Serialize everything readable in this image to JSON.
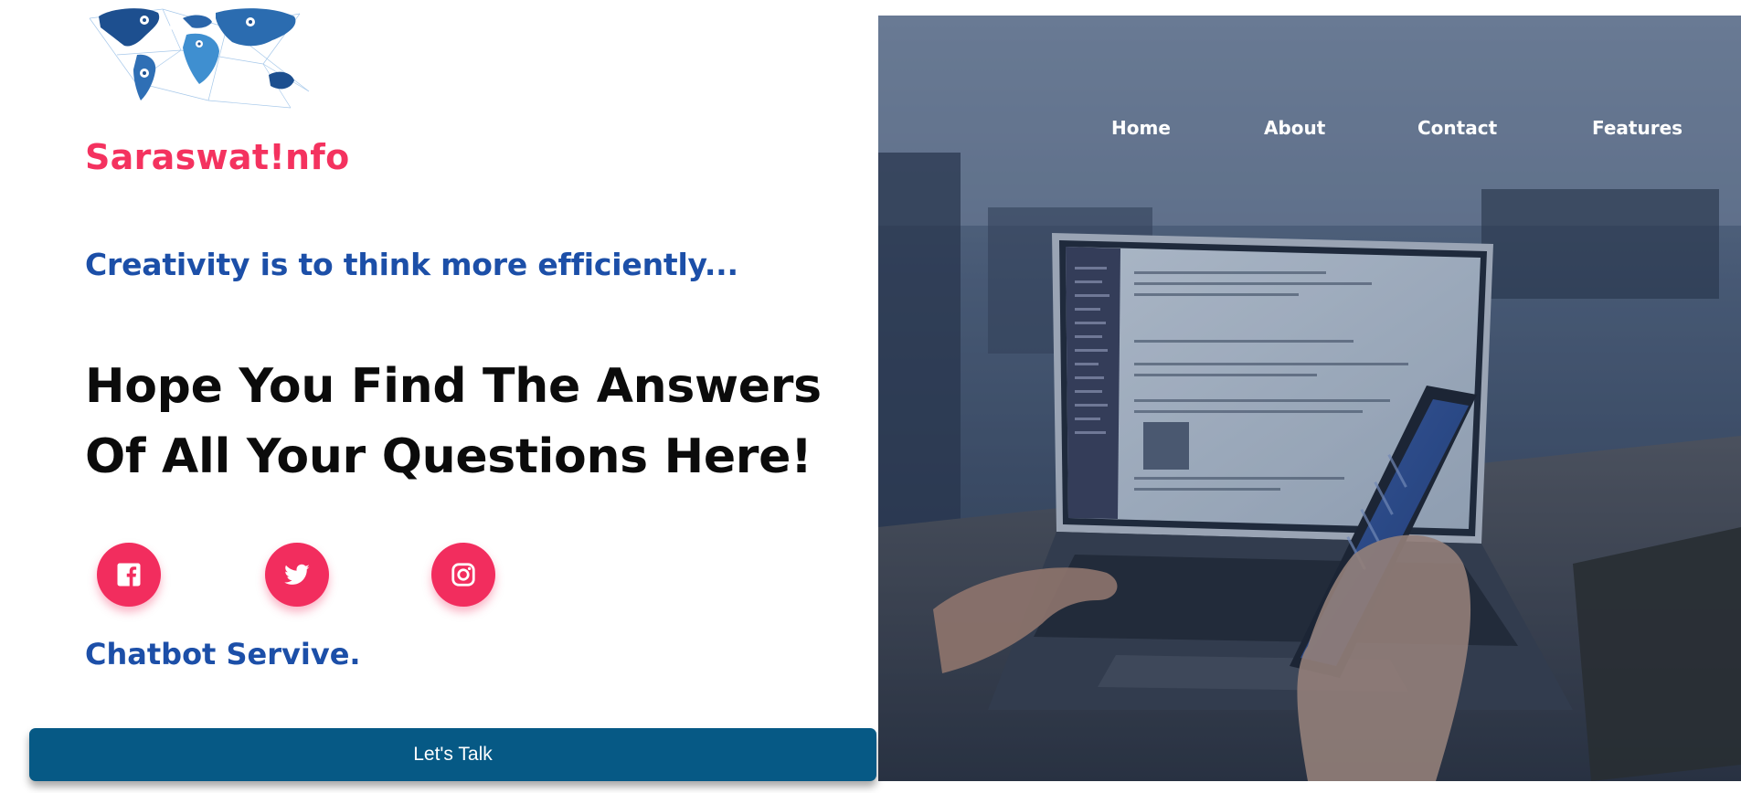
{
  "brand": {
    "name": "Saraswat!nfo",
    "logo_icon": "world-map-network-icon"
  },
  "nav": {
    "items": [
      {
        "label": "Home"
      },
      {
        "label": "About"
      },
      {
        "label": "Contact"
      },
      {
        "label": "Features"
      }
    ]
  },
  "hero": {
    "tagline": "Creativity is to think more efficiently...",
    "headline_line1": "Hope You Find The Answers",
    "headline_line2": "Of All Your Questions Here!",
    "image_icon": "laptop-and-phone-photo"
  },
  "social": [
    {
      "name": "facebook",
      "icon": "facebook-icon"
    },
    {
      "name": "twitter",
      "icon": "twitter-icon"
    },
    {
      "name": "instagram",
      "icon": "instagram-icon"
    }
  ],
  "service": {
    "label": "Chatbot Servive."
  },
  "cta": {
    "label": "Let's Talk"
  },
  "colors": {
    "brand_pink": "#f4325f",
    "accent_blue": "#1c4fa8",
    "cta_blue": "#065985",
    "headline": "#0b0b0b"
  }
}
